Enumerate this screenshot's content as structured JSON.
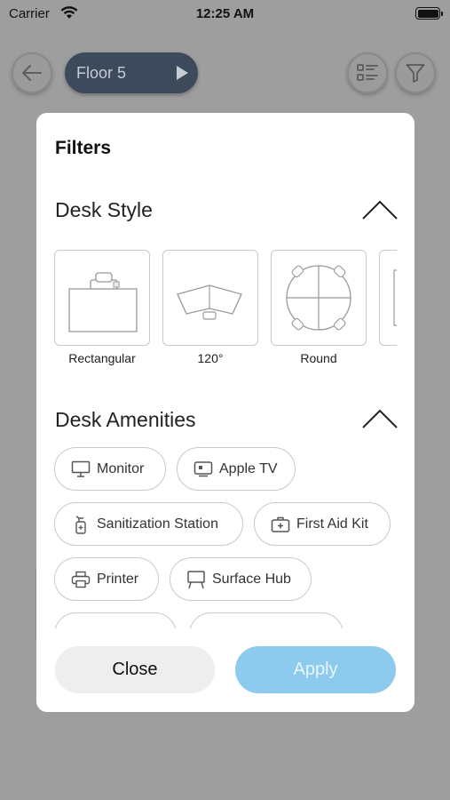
{
  "status_bar": {
    "carrier": "Carrier",
    "time": "12:25 AM"
  },
  "top_bar": {
    "floor_label": "Floor 5"
  },
  "modal": {
    "title": "Filters",
    "desk_style": {
      "title": "Desk Style",
      "options": [
        {
          "label": "Rectangular",
          "icon": "rectangular-desk-icon"
        },
        {
          "label": "120°",
          "icon": "120-degree-desk-icon"
        },
        {
          "label": "Round",
          "icon": "round-desk-icon"
        }
      ]
    },
    "desk_amenities": {
      "title": "Desk Amenities",
      "chips": [
        {
          "label": "Monitor",
          "icon": "monitor-icon"
        },
        {
          "label": "Apple TV",
          "icon": "apple-tv-icon"
        },
        {
          "label": "Sanitization Station",
          "icon": "sanitizer-icon"
        },
        {
          "label": "First Aid Kit",
          "icon": "first-aid-icon"
        },
        {
          "label": "Printer",
          "icon": "printer-icon"
        },
        {
          "label": "Surface Hub",
          "icon": "surface-hub-icon"
        }
      ]
    },
    "buttons": {
      "close": "Close",
      "apply": "Apply"
    }
  },
  "colors": {
    "overlay_bg": "#9e9e9e",
    "floor_pill": "#3d4a5c",
    "apply_button": "#8ccbee",
    "close_button": "#efeeee"
  }
}
